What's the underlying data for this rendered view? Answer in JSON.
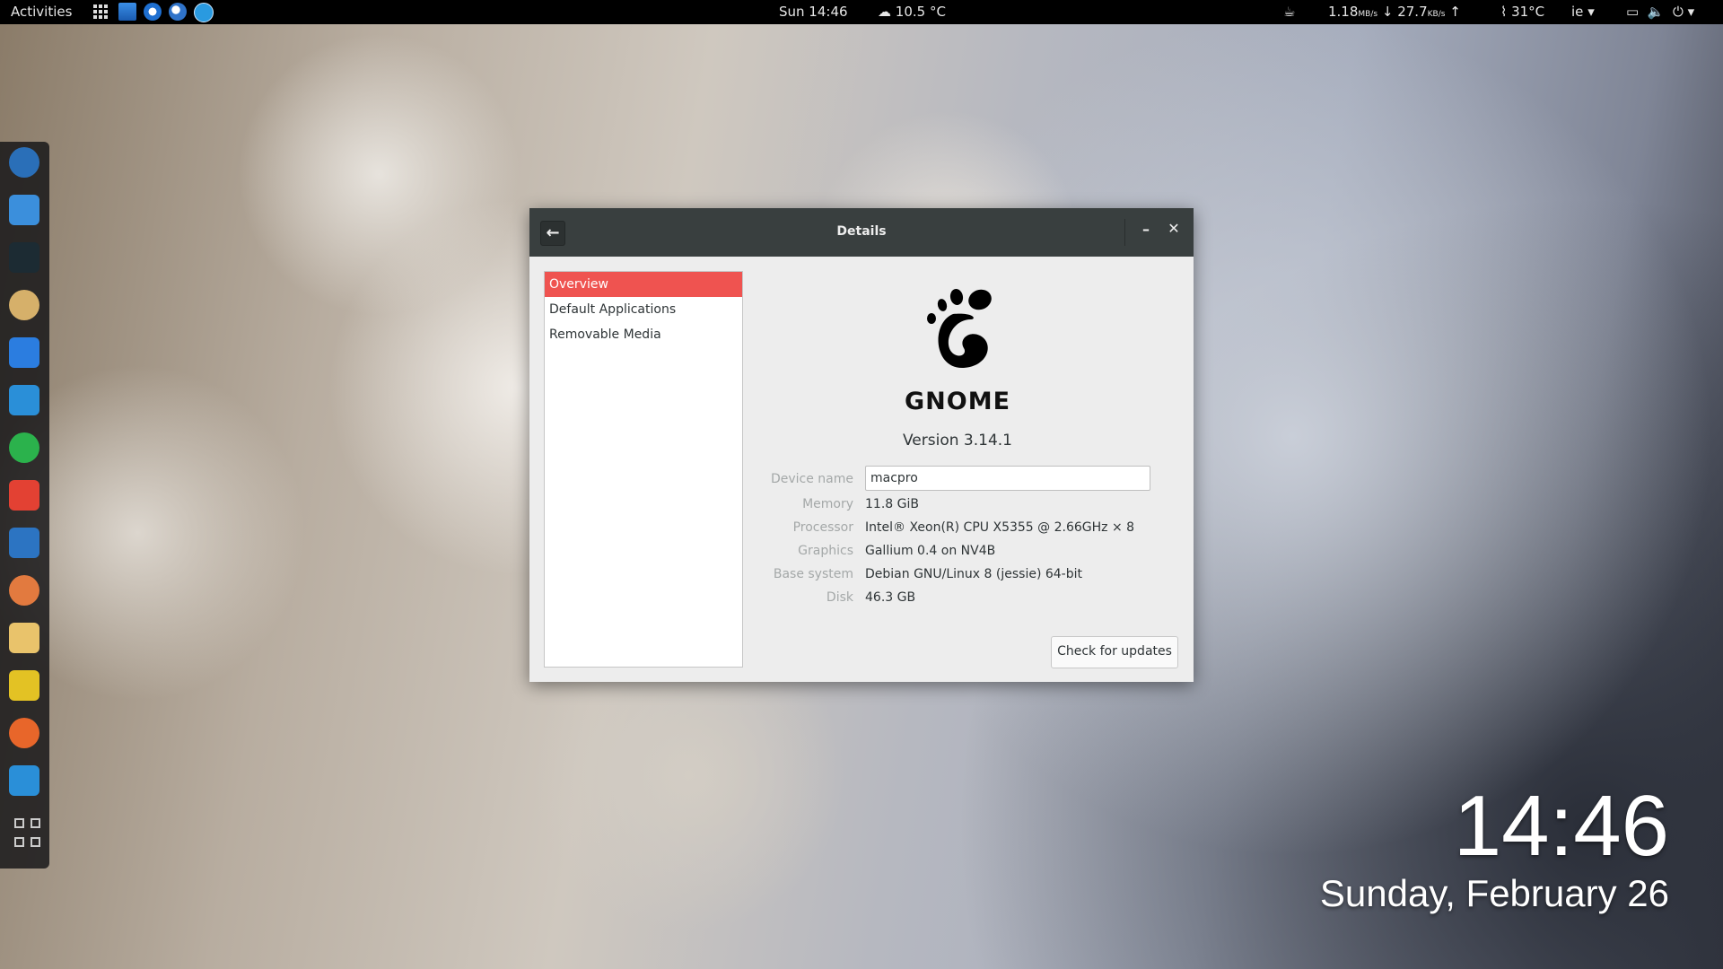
{
  "topbar": {
    "activities": "Activities",
    "clock": "Sun 14:46",
    "weather": "10.5 °C",
    "net_down_value": "1.18",
    "net_down_unit": "MB/s",
    "net_up_value": "27.7",
    "net_up_unit": "KB/s",
    "temp": "31°C",
    "lang": "ie"
  },
  "dock": {
    "items": [
      {
        "name": "web-browser-icon",
        "color": "#2a6fb8"
      },
      {
        "name": "files-icon",
        "color": "#3b8fdc"
      },
      {
        "name": "terminal-icon",
        "color": "#1c2b33"
      },
      {
        "name": "tape-player-icon",
        "color": "#d6b06a"
      },
      {
        "name": "document-writer-icon",
        "color": "#2b7de0"
      },
      {
        "name": "settings-tweak-icon",
        "color": "#2a8fd8"
      },
      {
        "name": "spotify-icon",
        "color": "#2bb24c"
      },
      {
        "name": "chrome-icon",
        "color": "#e34133"
      },
      {
        "name": "system-monitor-icon",
        "color": "#2c74c2"
      },
      {
        "name": "software-center-icon",
        "color": "#e27a3f"
      },
      {
        "name": "mail-icon",
        "color": "#e9c36b"
      },
      {
        "name": "alert-icon",
        "color": "#e3c224"
      },
      {
        "name": "firefox-icon",
        "color": "#e8662a"
      },
      {
        "name": "network-tool-icon",
        "color": "#2a8fd8"
      }
    ]
  },
  "dialog": {
    "title": "Details",
    "sidebar": [
      "Overview",
      "Default Applications",
      "Removable Media"
    ],
    "logo_text": "GNOME",
    "version": "Version 3.14.1",
    "device_label": "Device name",
    "device_value": "macpro",
    "rows": [
      {
        "label": "Memory",
        "value": "11.8 GiB"
      },
      {
        "label": "Processor",
        "value": "Intel® Xeon(R) CPU X5355 @ 2.66GHz × 8"
      },
      {
        "label": "Graphics",
        "value": "Gallium 0.4 on NV4B"
      },
      {
        "label": "Base system",
        "value": "Debian GNU/Linux 8 (jessie) 64-bit"
      },
      {
        "label": "Disk",
        "value": "46.3 GB"
      }
    ],
    "update_button": "Check for updates"
  },
  "desktop": {
    "clock": "14:46",
    "date": "Sunday, February 26"
  }
}
